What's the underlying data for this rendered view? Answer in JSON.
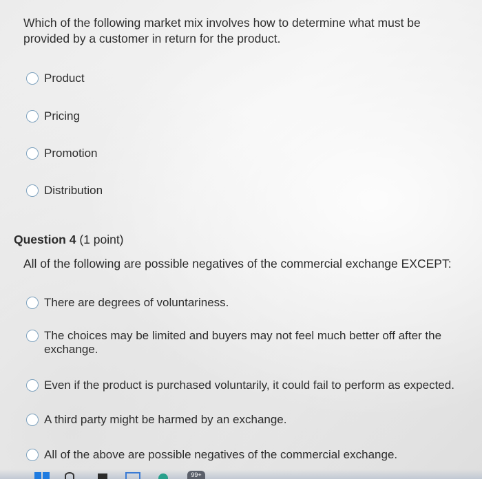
{
  "question3": {
    "text": "Which of the following market mix involves how to determine what must be provided by a customer in return for the product.",
    "options": [
      "Product",
      "Pricing",
      "Promotion",
      "Distribution"
    ]
  },
  "question4": {
    "title": "Question 4",
    "points": "(1 point)",
    "text": "All of the following are possible negatives of the commercial exchange EXCEPT:",
    "options": [
      "There are degrees of voluntariness.",
      "The choices may be limited and buyers may not feel much better off after the exchange.",
      "Even if the product is purchased voluntarily, it could fail to perform as expected.",
      "A third party might be harmed by an exchange.",
      "All of the above are possible negatives of the commercial exchange."
    ]
  },
  "taskbar": {
    "notification_badge": "99+",
    "icons": [
      "windows-icon",
      "search-icon",
      "task-view-icon",
      "store-icon",
      "edge-icon"
    ]
  }
}
